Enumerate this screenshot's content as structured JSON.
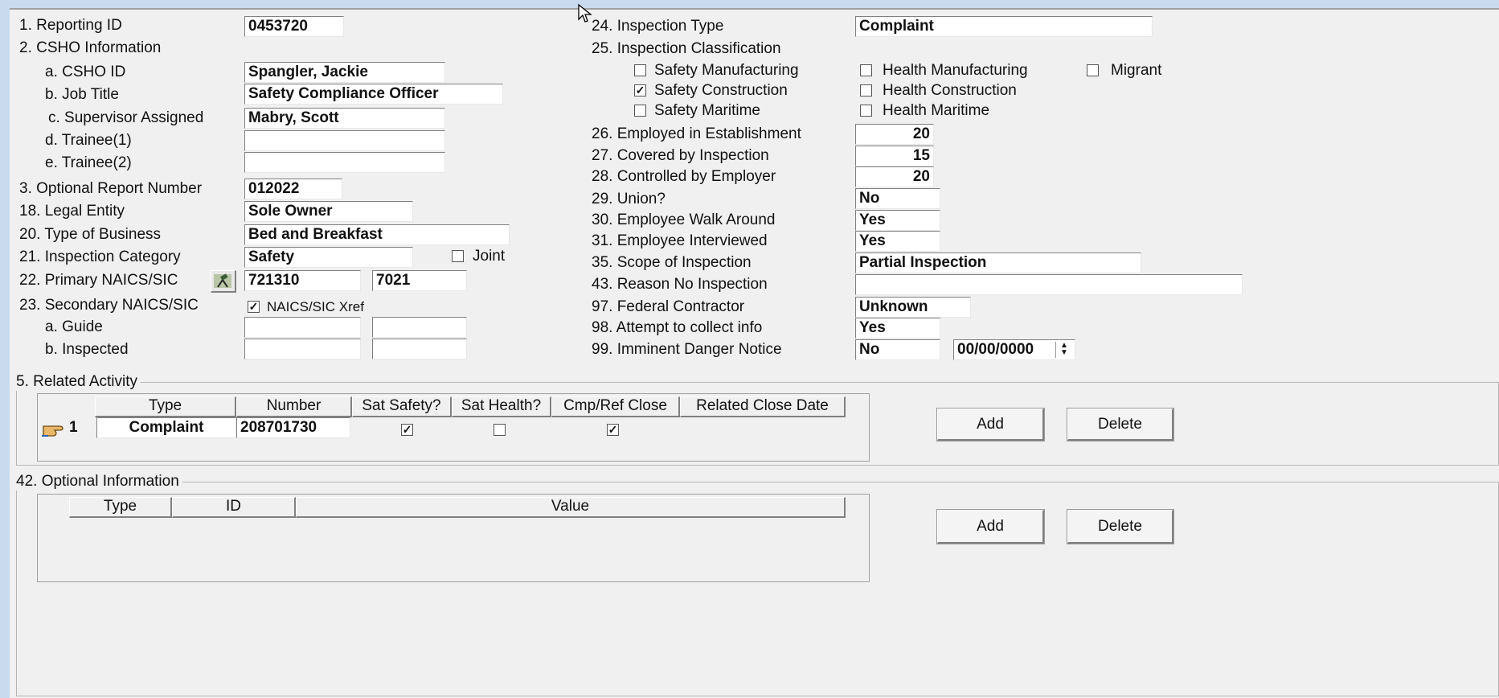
{
  "left": {
    "reporting_id": {
      "label": "1. Reporting ID",
      "value": "0453720"
    },
    "csho_info_label": "2. CSHO Information",
    "csho_id": {
      "label": "a. CSHO ID",
      "value": "Spangler, Jackie"
    },
    "job_title": {
      "label": "b. Job Title",
      "value": "Safety Compliance Officer"
    },
    "supervisor": {
      "label": "c. Supervisor Assigned",
      "value": "Mabry, Scott"
    },
    "trainee1": {
      "label": "d. Trainee(1)",
      "value": ""
    },
    "trainee2": {
      "label": "e. Trainee(2)",
      "value": ""
    },
    "optional_report": {
      "label": "3. Optional Report Number",
      "value": "012022"
    },
    "legal_entity": {
      "label": "18. Legal Entity",
      "value": "Sole Owner"
    },
    "type_business": {
      "label": "20. Type of Business",
      "value": "Bed and Breakfast"
    },
    "inspection_category": {
      "label": "21. Inspection Category",
      "value": "Safety",
      "joint_label": "Joint",
      "joint_checked": false
    },
    "primary_naics": {
      "label": "22. Primary NAICS/SIC",
      "naics": "721310",
      "sic": "7021"
    },
    "secondary_naics": {
      "label": "23. Secondary NAICS/SIC",
      "xref_label": "NAICS/SIC Xref",
      "xref_checked": true
    },
    "guide": {
      "label": "a. Guide",
      "naics": "",
      "sic": ""
    },
    "inspected": {
      "label": "b. Inspected",
      "naics": "",
      "sic": ""
    }
  },
  "right": {
    "inspection_type": {
      "label": "24. Inspection Type",
      "value": "Complaint"
    },
    "classification_label": "25. Inspection Classification",
    "classifications": {
      "safety_manufacturing": {
        "label": "Safety Manufacturing",
        "checked": false
      },
      "health_manufacturing": {
        "label": "Health Manufacturing",
        "checked": false
      },
      "migrant": {
        "label": "Migrant",
        "checked": false
      },
      "safety_construction": {
        "label": "Safety Construction",
        "checked": true
      },
      "health_construction": {
        "label": "Health Construction",
        "checked": false
      },
      "safety_maritime": {
        "label": "Safety Maritime",
        "checked": false
      },
      "health_maritime": {
        "label": "Health Maritime",
        "checked": false
      }
    },
    "employed": {
      "label": "26. Employed in Establishment",
      "value": "20"
    },
    "covered": {
      "label": "27. Covered by Inspection",
      "value": "15"
    },
    "controlled": {
      "label": "28. Controlled by Employer",
      "value": "20"
    },
    "union": {
      "label": "29. Union?",
      "value": "No"
    },
    "walk_around": {
      "label": "30. Employee Walk Around",
      "value": "Yes"
    },
    "interviewed": {
      "label": "31. Employee Interviewed",
      "value": "Yes"
    },
    "scope": {
      "label": "35. Scope of Inspection",
      "value": "Partial Inspection"
    },
    "reason_no_inspection": {
      "label": "43. Reason No Inspection",
      "value": ""
    },
    "federal_contractor": {
      "label": "97. Federal Contractor",
      "value": "Unknown"
    },
    "attempt_collect": {
      "label": "98. Attempt to collect info",
      "value": "Yes"
    },
    "imminent_danger": {
      "label": "99. Imminent Danger Notice",
      "value": "No",
      "date": "00/00/0000"
    }
  },
  "related_activity": {
    "title": "5. Related Activity",
    "columns": [
      "Type",
      "Number",
      "Sat Safety?",
      "Sat Health?",
      "Cmp/Ref Close",
      "Related Close Date"
    ],
    "rows": [
      {
        "index": "1",
        "type": "Complaint",
        "number": "208701730",
        "sat_safety": true,
        "sat_health": false,
        "cmp_ref_close": true,
        "related_close_date": ""
      }
    ],
    "add_label": "Add",
    "delete_label": "Delete"
  },
  "optional_information": {
    "title": "42. Optional Information",
    "columns": [
      "Type",
      "ID",
      "Value"
    ],
    "add_label": "Add",
    "delete_label": "Delete"
  }
}
